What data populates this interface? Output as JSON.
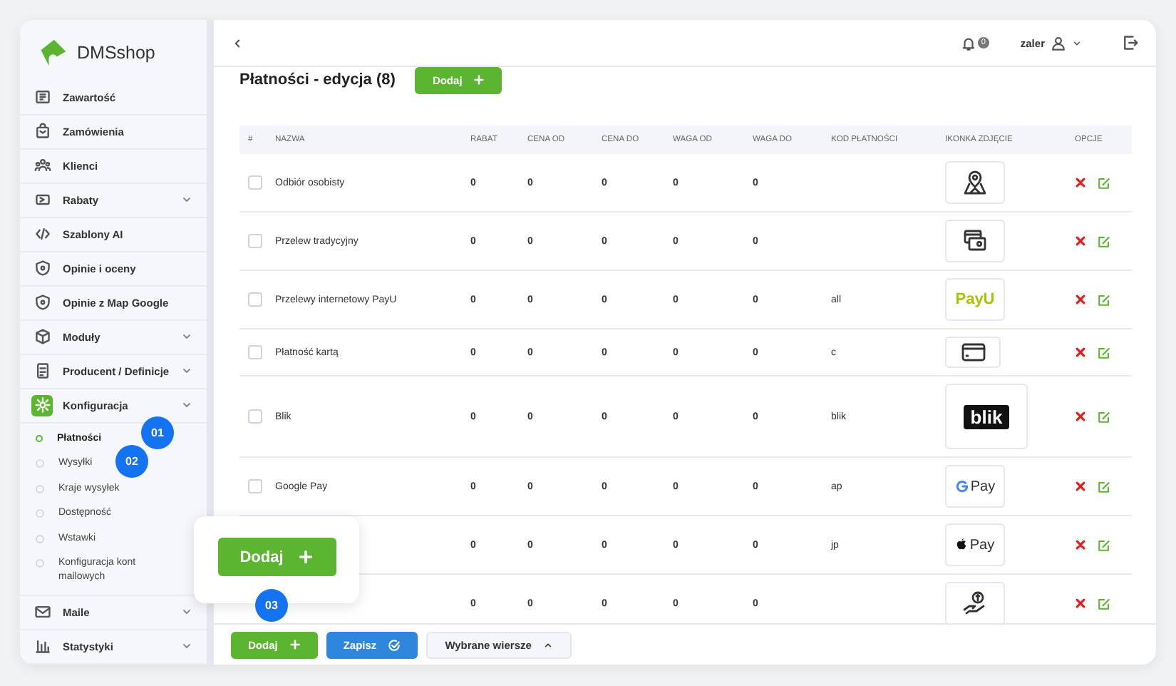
{
  "sidebar": {
    "logo": "DMSshop",
    "items": [
      {
        "label": "Zawartość",
        "expandable": false,
        "selected": false
      },
      {
        "label": "Zamówienia",
        "expandable": false,
        "selected": false
      },
      {
        "label": "Klienci",
        "expandable": false,
        "selected": false
      },
      {
        "label": "Rabaty",
        "expandable": true,
        "selected": false
      },
      {
        "label": "Szablony AI",
        "expandable": false,
        "selected": false
      },
      {
        "label": "Opinie i oceny",
        "expandable": false,
        "selected": false
      },
      {
        "label": "Opinie z Map Google",
        "expandable": false,
        "selected": false
      },
      {
        "label": "Moduły",
        "expandable": true,
        "selected": false
      },
      {
        "label": "Producent / Definicje",
        "expandable": true,
        "selected": false
      },
      {
        "label": "Konfiguracja",
        "expandable": true,
        "selected": true,
        "children": [
          {
            "label": "Płatności",
            "selected": true
          },
          {
            "label": "Wysyłki",
            "selected": false
          },
          {
            "label": "Kraje wysyłek",
            "selected": false
          },
          {
            "label": "Dostępność",
            "selected": false
          },
          {
            "label": "Wstawki",
            "selected": false
          },
          {
            "label": "Konfiguracja kont mailowych",
            "selected": false
          }
        ]
      },
      {
        "label": "Maile",
        "expandable": true,
        "selected": false
      },
      {
        "label": "Statystyki",
        "expandable": true,
        "selected": false
      }
    ]
  },
  "topbar": {
    "notifications": "0",
    "user": "zaler"
  },
  "page": {
    "title": "Płatności - edycja (8)",
    "add_button": "Dodaj"
  },
  "table": {
    "columns": [
      "#",
      "NAZWA",
      "RABAT",
      "CENA OD",
      "CENA DO",
      "WAGA OD",
      "WAGA DO",
      "KOD PŁATNOŚCI",
      "IKONKA ZDJĘCIE",
      "OPCJE"
    ],
    "rows": [
      {
        "checked": false,
        "name": "Odbiór osobisty",
        "values": [
          "0",
          "0",
          "0",
          "0",
          "0"
        ],
        "kind": "pickup"
      },
      {
        "checked": false,
        "name": "Przelew tradycyjny",
        "values": [
          "0",
          "0",
          "0",
          "0",
          "0"
        ],
        "kind": "transfer"
      },
      {
        "checked": false,
        "name": "Przelewy internetowy PayU",
        "values": [
          "0",
          "0",
          "0",
          "0",
          "0"
        ],
        "code": "all",
        "kind": "payu",
        "logo_text": "PayU"
      },
      {
        "checked": false,
        "name": "Płatność kartą",
        "values": [
          "0",
          "0",
          "0",
          "0",
          "0"
        ],
        "code": "c",
        "kind": "card"
      },
      {
        "checked": false,
        "name": "Blik",
        "values": [
          "0",
          "0",
          "0",
          "0",
          "0"
        ],
        "code": "blik",
        "kind": "blik",
        "logo_text": "blik"
      },
      {
        "checked": false,
        "name": "Google Pay",
        "values": [
          "0",
          "0",
          "0",
          "0",
          "0"
        ],
        "code": "ap",
        "kind": "gpay",
        "logo_text": "Pay"
      },
      {
        "values": [
          "0",
          "0",
          "0",
          "0",
          "0"
        ],
        "code": "jp",
        "kind": "applepay",
        "logo_text": "Pay"
      },
      {
        "values": [
          "0",
          "0",
          "0",
          "0",
          "0"
        ],
        "kind": "cash"
      }
    ]
  },
  "toolbar": {
    "add": "Dodaj",
    "save": "Zapisz",
    "selected_rows": "Wybrane wiersze"
  },
  "callout": {
    "button": "Dodaj"
  },
  "steps": [
    "01",
    "02",
    "03"
  ]
}
